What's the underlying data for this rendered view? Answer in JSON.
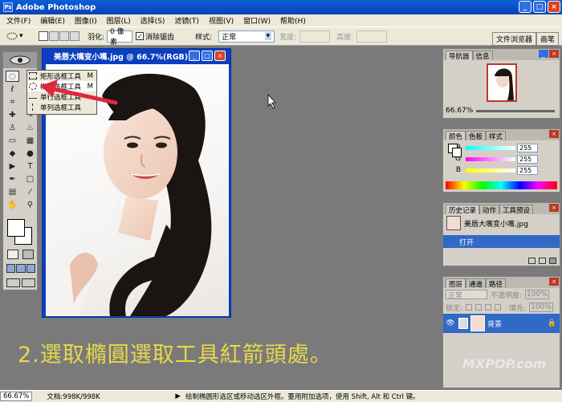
{
  "app": {
    "title": "Adobe Photoshop",
    "icon_text": "Ps"
  },
  "window_buttons": [
    "_",
    "□",
    "×"
  ],
  "menu": [
    "文件(F)",
    "编辑(E)",
    "图像(I)",
    "图层(L)",
    "选择(S)",
    "滤镜(T)",
    "视图(V)",
    "窗口(W)",
    "帮助(H)"
  ],
  "options": {
    "feather_label": "羽化:",
    "feather_value": "0 像素",
    "antialias_label": "消除锯齿",
    "style_label": "样式:",
    "style_value": "正常",
    "width_label": "宽度:",
    "height_label": "高度:",
    "palette_tabs": [
      "文件浏览器",
      "画笔"
    ]
  },
  "flyout": {
    "items": [
      {
        "label": "矩形选框工具",
        "key": "M"
      },
      {
        "label": "椭圆选框工具",
        "key": "M"
      },
      {
        "label": "单行选框工具",
        "key": ""
      },
      {
        "label": "单列选框工具",
        "key": ""
      }
    ]
  },
  "document": {
    "title": "美唇大嘴变小嘴.jpg @ 66.7%(RGB)"
  },
  "caption": "2.選取橢圓選取工具紅箭頭處。",
  "watermark": "MXPOP.com",
  "status": {
    "zoom": "66.67%",
    "doc_info": "文档:998K/998K",
    "hint": "绘制椭圆形选区或移动选区外框。要用附加选项，使用 Shift, Alt 和 Ctrl 键。"
  },
  "navigator": {
    "tabs": [
      "导航器",
      "信息"
    ],
    "zoom": "66.67%"
  },
  "color": {
    "tabs": [
      "颜色",
      "色板",
      "样式"
    ],
    "channels": [
      {
        "label": "R",
        "value": "255"
      },
      {
        "label": "G",
        "value": "255"
      },
      {
        "label": "B",
        "value": "255"
      }
    ]
  },
  "history": {
    "tabs": [
      "历史记录",
      "动作",
      "工具预设"
    ],
    "snapshot": "美唇大嘴变小嘴.jpg",
    "state": "打开"
  },
  "layers": {
    "tabs": [
      "图层",
      "通道",
      "路径"
    ],
    "blend_mode": "正常",
    "opacity_label": "不透明度:",
    "opacity_value": "100%",
    "lock_label": "锁定:",
    "fill_label": "填充:",
    "fill_value": "100%",
    "layer_name": "背景"
  },
  "colors": {
    "title_bar": "#0843b5",
    "arrow": "#e0283c",
    "caption": "#e8d84a"
  }
}
